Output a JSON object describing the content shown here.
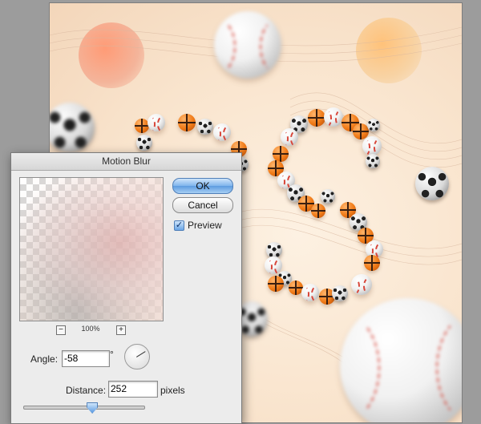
{
  "dialog": {
    "title": "Motion Blur",
    "ok_label": "OK",
    "cancel_label": "Cancel",
    "preview_label": "Preview",
    "preview_checked": true,
    "zoom_out": "−",
    "zoom_in": "+",
    "zoom_level": "100%",
    "angle_label": "Angle:",
    "angle_value": "-58",
    "angle_unit": "°",
    "distance_label": "Distance:",
    "distance_value": "252",
    "distance_unit": "pixels",
    "distance_slider_fraction": 0.56
  },
  "colors": {
    "accent_blue": "#5d9be0",
    "canvas_bg": "#fbe9d6",
    "baseball_stitch": "#d8463a",
    "basketball": "#f07b18"
  },
  "icons": [
    "checkbox-check-icon",
    "zoom-out-icon",
    "zoom-in-icon",
    "angle-dial-icon",
    "slider-thumb-icon"
  ]
}
